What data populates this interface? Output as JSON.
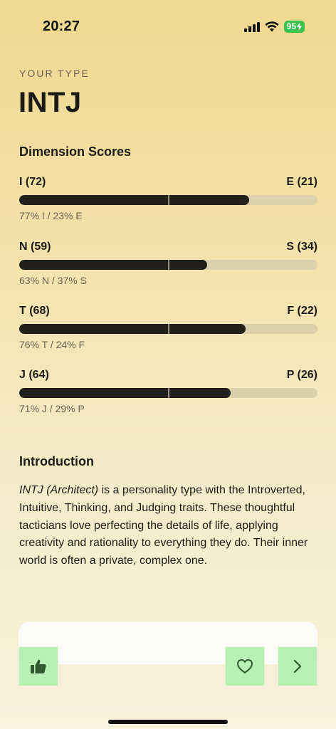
{
  "status_bar": {
    "time": "20:27",
    "battery": "95"
  },
  "header": {
    "eyebrow": "YOUR TYPE",
    "type": "INTJ"
  },
  "dimensions_title": "Dimension Scores",
  "dimensions": [
    {
      "left": "I (72)",
      "right": "E (21)",
      "percent_text": "77% I / 23% E",
      "fill": 0.77
    },
    {
      "left": "N (59)",
      "right": "S (34)",
      "percent_text": "63% N / 37% S",
      "fill": 0.63
    },
    {
      "left": "T (68)",
      "right": "F (22)",
      "percent_text": "76% T / 24% F",
      "fill": 0.76
    },
    {
      "left": "J (64)",
      "right": "P (26)",
      "percent_text": "71% J / 29% P",
      "fill": 0.71
    }
  ],
  "introduction": {
    "title": "Introduction",
    "italic_lead": "INTJ (Architect)",
    "body": " is a personality type with the Introverted, Intuitive, Thinking, and Judging traits. These thoughtful tacticians love perfecting the details of life, applying creativity and rationality to everything they do. Their inner world is often a private, complex one."
  },
  "actions": {
    "like_icon": "thumbs-up-icon",
    "favorite_icon": "heart-icon",
    "next_icon": "chevron-right-icon",
    "icon_color": "#2f5a2c",
    "button_color": "#b9f0b3"
  }
}
